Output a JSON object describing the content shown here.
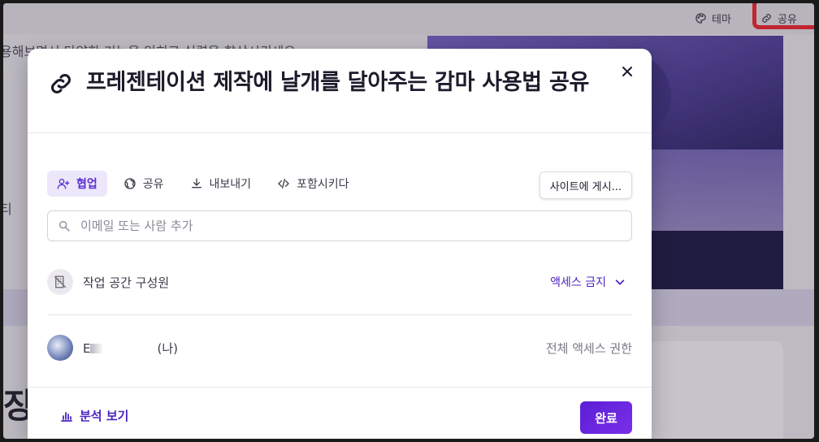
{
  "background": {
    "theme_label": "테마",
    "share_label": "공유",
    "text_line1": "용해보면서 다양한 기능을 익히고 실력을 향상시키세요",
    "text_line2": "티",
    "heading_fragment": "장"
  },
  "modal": {
    "title": "프레젠테이션 제작에 날개를 달아주는 감마 사용법 공유",
    "tabs": [
      {
        "label": "협업",
        "icon": "add-user-icon",
        "active": true
      },
      {
        "label": "공유",
        "icon": "globe-icon",
        "active": false
      },
      {
        "label": "내보내기",
        "icon": "download-icon",
        "active": false
      },
      {
        "label": "포함시키다",
        "icon": "code-icon",
        "active": false
      }
    ],
    "publish_label": "사이트에 게시...",
    "search": {
      "placeholder": "이메일 또는 사람 추가",
      "value": ""
    },
    "workspace_row": {
      "label": "작업 공간 구성원",
      "access": "액세스 금지"
    },
    "user_row": {
      "name_visible": "E",
      "name_suffix": "(나)",
      "access": "전체 액세스 권한"
    },
    "footer": {
      "analytics_label": "분석 보기",
      "done_label": "완료"
    }
  },
  "colors": {
    "accent": "#5a2ed0",
    "highlight": "#e0222e"
  }
}
